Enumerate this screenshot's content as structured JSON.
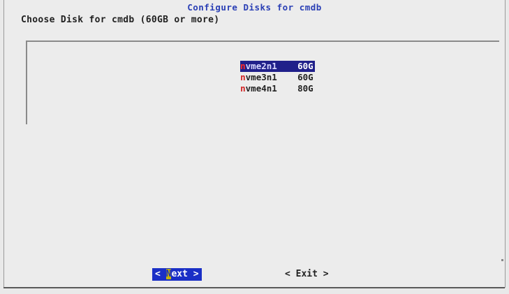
{
  "dialog": {
    "title": "Configure Disks for cmdb",
    "prompt": "Choose Disk for cmdb (60GB or more)"
  },
  "disks": [
    {
      "hotkey": "n",
      "rest": "vme2n1",
      "size": "60G",
      "selected": true
    },
    {
      "hotkey": "n",
      "rest": "vme3n1",
      "size": "60G",
      "selected": false
    },
    {
      "hotkey": "n",
      "rest": "vme4n1",
      "size": "80G",
      "selected": false
    }
  ],
  "buttons": {
    "next": {
      "left": "< ",
      "hotkey": "N",
      "rest": "ext",
      "right": " >"
    },
    "exit": {
      "label": "< Exit >"
    }
  },
  "colors": {
    "title": "#2a3fb5",
    "selected_bg": "#20208a",
    "button_bg": "#1a2fc6",
    "hotkey": "#d12424"
  }
}
